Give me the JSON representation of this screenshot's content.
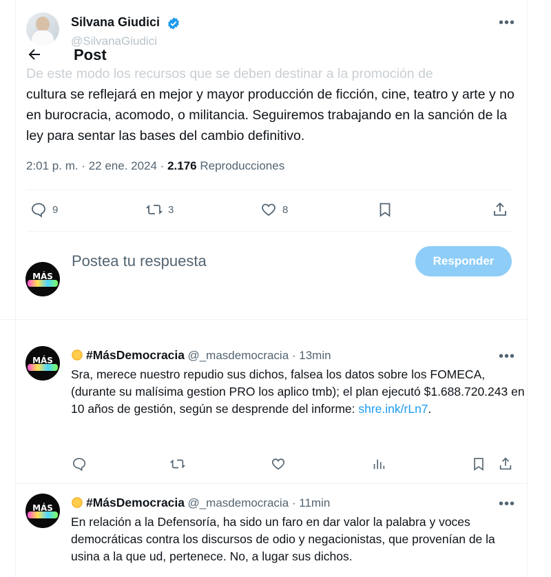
{
  "author": {
    "name": "Silvana Giudici",
    "handle": "@SilvanaGiudici",
    "verified_color": "#1d9bf0"
  },
  "header": {
    "title": "Post",
    "back_icon": "arrow-left-icon",
    "more_icon": "more-icon"
  },
  "tweet": {
    "text_faded": "De este modo los recursos que se deben destinar a la promoción de",
    "text": "cultura se reflejará en mejor y mayor producción de ficción, cine, teatro y arte y no en burocracia, acomodo, o militancia. Seguiremos trabajando en la sanción de la ley para sentar las bases del cambio definitivo.",
    "time": "2:01 p. m. · 22 ene. 2024 · ",
    "views": "2.176",
    "views_label": " Reproducciones",
    "actions": {
      "replies": "9",
      "retweets": "3",
      "likes": "8"
    }
  },
  "composer": {
    "placeholder": "Postea tu respuesta",
    "button": "Responder",
    "button_color": "#8ecdf8"
  },
  "replies": [
    {
      "name": "#MásDemocracia",
      "handle": "@_masdemocracia · 13min",
      "text": "Sra, merece nuestro repudio sus dichos, falsea los datos sobre los FOMECA, (durante su malísima gestion PRO los aplico tmb); el plan ejecutó $1.688.720.243 en 10 años de gestión, según se desprende del informe: ",
      "link": "shre.ink/rLn7",
      "after_link": "."
    },
    {
      "name": "#MásDemocracia",
      "handle": "@_masdemocracia · 11min",
      "text": "En relación a la Defensoría, ha sido un faro en dar valor la palabra y voces democráticas contra los discursos de odio y negacionistas, que provenían de la usina a la que ud, pertenece. No, a lugar sus dichos."
    }
  ],
  "avatar_text": {
    "line1": "MÁS"
  }
}
